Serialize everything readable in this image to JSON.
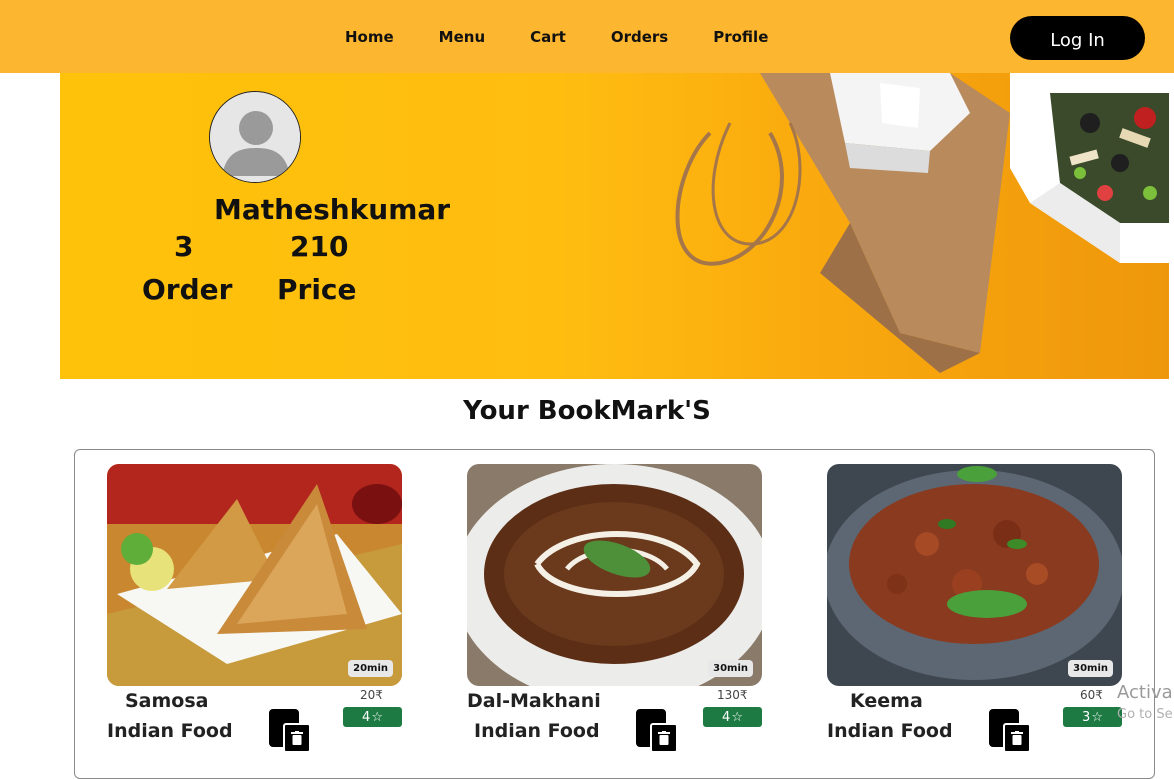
{
  "nav": {
    "links": [
      "Home",
      "Menu",
      "Cart",
      "Orders",
      "Profile"
    ],
    "login_label": "Log In"
  },
  "profile": {
    "name": "Matheshkumar",
    "order_count": "3",
    "order_label": "Order",
    "price_value": "210",
    "price_label": "Price"
  },
  "bookmarks": {
    "title": "Your BookMark'S",
    "items": [
      {
        "name": "Samosa",
        "category": "Indian Food",
        "price": "20₹",
        "rating": "4",
        "time": "20min"
      },
      {
        "name": "Dal-Makhani",
        "category": "Indian Food",
        "price": "130₹",
        "rating": "4",
        "time": "30min"
      },
      {
        "name": "Keema",
        "category": "Indian Food",
        "price": "60₹",
        "rating": "3",
        "time": "30min"
      }
    ]
  },
  "watermark": {
    "line1": "Activa",
    "line2": "Go to Se"
  },
  "colors": {
    "navbar": "#FDB62F",
    "banner": "#FFC20A",
    "rating": "#1D7A43",
    "button": "#000000"
  },
  "icons": [
    "avatar-icon",
    "star-icon",
    "bookmark-icon",
    "trash-icon"
  ]
}
